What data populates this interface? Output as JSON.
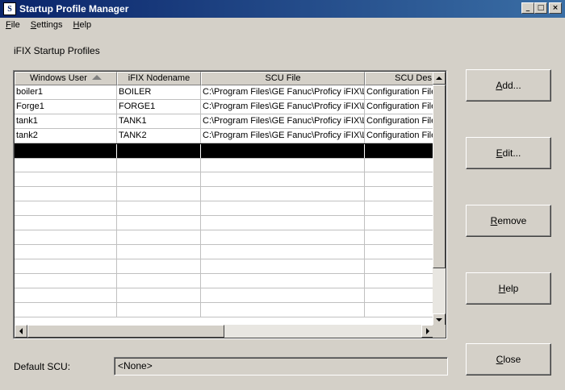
{
  "window": {
    "title": "Startup Profile Manager"
  },
  "title_buttons": {
    "minimize": "_",
    "maximize": "□",
    "close": "×"
  },
  "menu": [
    {
      "accel": "F",
      "rest": "ile"
    },
    {
      "accel": "S",
      "rest": "ettings"
    },
    {
      "accel": "H",
      "rest": "elp"
    }
  ],
  "profiles_label": "iFIX Startup Profiles",
  "table": {
    "columns": [
      "Windows User",
      "iFIX Nodename",
      "SCU File",
      "SCU Des"
    ],
    "sorted_column_icon": "sort-ascending-icon",
    "rows": [
      [
        "boiler1",
        "BOILER",
        "C:\\Program Files\\GE Fanuc\\Proficy iFIX\\L",
        "Configuration File"
      ],
      [
        "Forge1",
        "FORGE1",
        "C:\\Program Files\\GE Fanuc\\Proficy iFIX\\L",
        "Configuration File"
      ],
      [
        "tank1",
        "TANK1",
        "C:\\Program Files\\GE Fanuc\\Proficy iFIX\\L",
        "Configuration File"
      ],
      [
        "tank2",
        "TANK2",
        "C:\\Program Files\\GE Fanuc\\Proficy iFIX\\L",
        "Configuration File"
      ]
    ]
  },
  "buttons": {
    "add": {
      "accel": "A",
      "rest": "dd..."
    },
    "edit": {
      "accel": "E",
      "rest": "dit..."
    },
    "remove": {
      "accel": "R",
      "rest": "emove"
    },
    "help": {
      "accel": "H",
      "rest": "elp"
    },
    "close": {
      "accel": "C",
      "rest": "lose"
    }
  },
  "default_scu": {
    "label": "Default SCU:",
    "value": "<None>"
  },
  "colors": {
    "title_start": "#0a246a",
    "title_end": "#3a6ea5",
    "face": "#d4d0c8",
    "selection": "#000000"
  }
}
